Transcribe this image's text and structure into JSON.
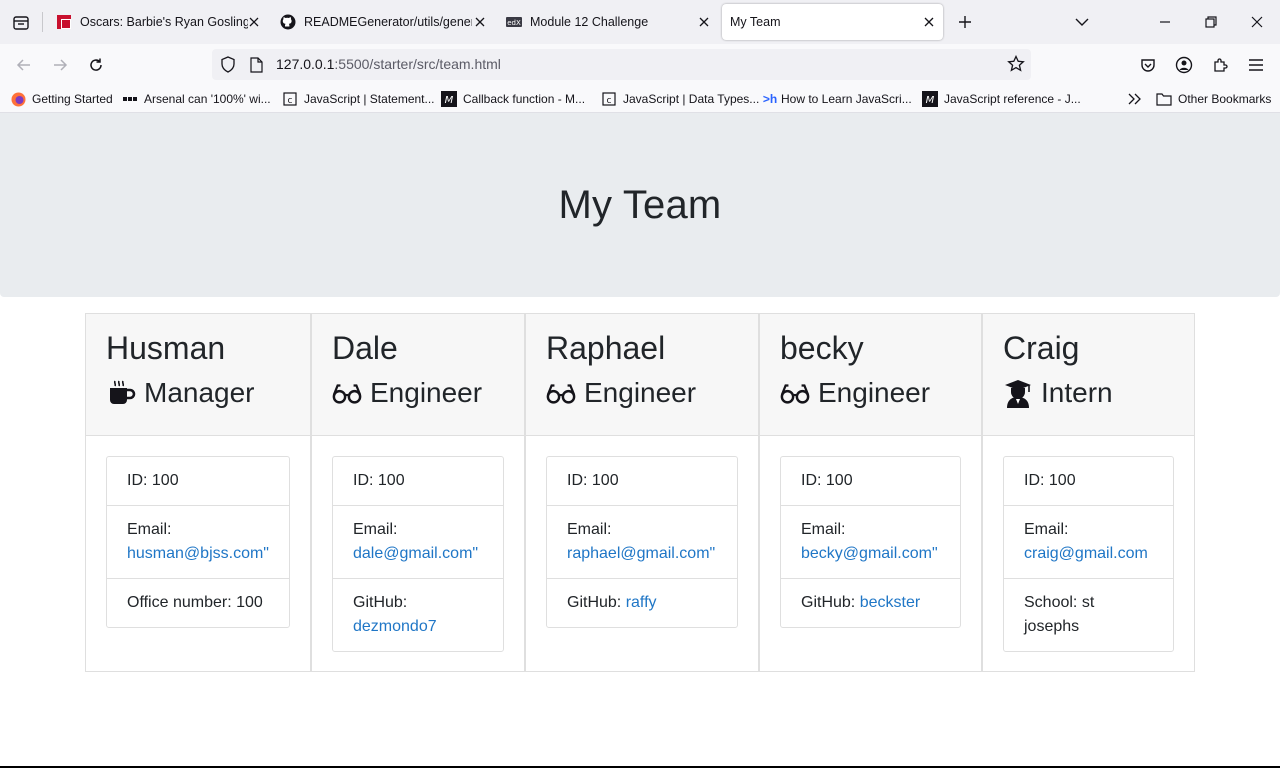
{
  "browser": {
    "tabs": [
      {
        "title": "Oscars: Barbie's Ryan Gosling 'd"
      },
      {
        "title": "READMEGenerator/utils/genera"
      },
      {
        "title": "Module 12 Challenge"
      },
      {
        "title": "My Team"
      }
    ],
    "url_host": "127.0.0.1",
    "url_path": ":5500/starter/src/team.html",
    "bookmarks": [
      {
        "label": "Getting Started"
      },
      {
        "label": "Arsenal can '100%' wi..."
      },
      {
        "label": "JavaScript | Statement..."
      },
      {
        "label": "Callback function - M..."
      },
      {
        "label": "JavaScript | Data Types..."
      },
      {
        "label": "How to Learn JavaScri..."
      },
      {
        "label": "JavaScript reference - J..."
      }
    ],
    "other_bookmarks": "Other Bookmarks"
  },
  "page": {
    "title": "My Team",
    "cards": [
      {
        "name": "Husman",
        "role": "Manager",
        "icon": "coffee-icon",
        "id": "ID: 100",
        "email_label": "Email:",
        "email": "husman@bjss.com\"",
        "extra_label": "Office number: 100",
        "extra_link": ""
      },
      {
        "name": "Dale",
        "role": "Engineer",
        "icon": "glasses-icon",
        "id": "ID: 100",
        "email_label": "Email:",
        "email": "dale@gmail.com\"",
        "extra_label": "GitHub:",
        "extra_link": "dezmondo7"
      },
      {
        "name": "Raphael",
        "role": "Engineer",
        "icon": "glasses-icon",
        "id": "ID: 100",
        "email_label": "Email:",
        "email": "raphael@gmail.com\"",
        "extra_label": "GitHub:",
        "extra_link": "raffy"
      },
      {
        "name": "becky",
        "role": "Engineer",
        "icon": "glasses-icon",
        "id": "ID: 100",
        "email_label": "Email:",
        "email": "becky@gmail.com\"",
        "extra_label": "GitHub:",
        "extra_link": "beckster"
      },
      {
        "name": "Craig",
        "role": "Intern",
        "icon": "graduate-icon",
        "id": "ID: 100",
        "email_label": "Email:",
        "email": "craig@gmail.com",
        "extra_label": "School: st josephs",
        "extra_link": ""
      }
    ]
  },
  "colors": {
    "link": "#1f76c6",
    "jumbotron": "#e9ecef",
    "card_header": "#f7f7f7"
  }
}
